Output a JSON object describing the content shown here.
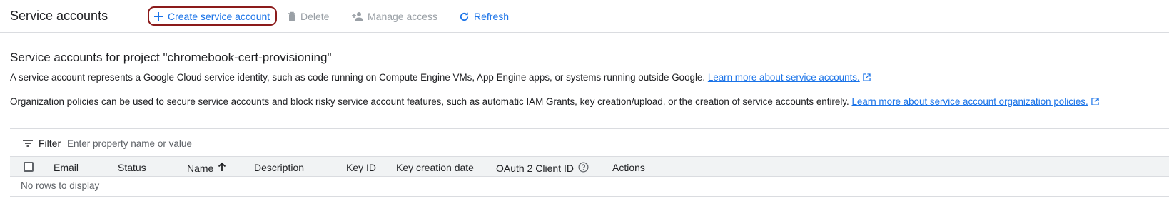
{
  "toolbar": {
    "title": "Service accounts",
    "create_label": "Create service account",
    "delete_label": "Delete",
    "manage_access_label": "Manage access",
    "refresh_label": "Refresh"
  },
  "content": {
    "section_title": "Service accounts for project \"chromebook-cert-provisioning\"",
    "para1_text": "A service account represents a Google Cloud service identity, such as code running on Compute Engine VMs, App Engine apps, or systems running outside Google. ",
    "para1_link": "Learn more about service accounts.",
    "para2_text": "Organization policies can be used to secure service accounts and block risky service account features, such as automatic IAM Grants, key creation/upload, or the creation of service accounts entirely. ",
    "para2_link": "Learn more about service account organization policies."
  },
  "filter": {
    "label": "Filter",
    "placeholder": "Enter property name or value"
  },
  "table": {
    "columns": [
      "Email",
      "Status",
      "Name",
      "Description",
      "Key ID",
      "Key creation date",
      "OAuth 2 Client ID",
      "Actions"
    ],
    "sorted_column": "Name",
    "sort_direction": "ascending",
    "empty_message": "No rows to display"
  },
  "icons": {
    "create": "plus-icon",
    "delete": "trash-icon",
    "manage_access": "person-add-icon",
    "refresh": "refresh-icon",
    "external_link": "external-link-icon",
    "filter": "filter-icon",
    "sort": "arrow-up-icon",
    "help": "help-circle-icon"
  },
  "colors": {
    "accent": "#1a73e8",
    "disabled": "#9aa0a6",
    "highlight_outline": "#8b1a1a",
    "header_bg": "#f1f3f4",
    "border": "#dadce0"
  }
}
